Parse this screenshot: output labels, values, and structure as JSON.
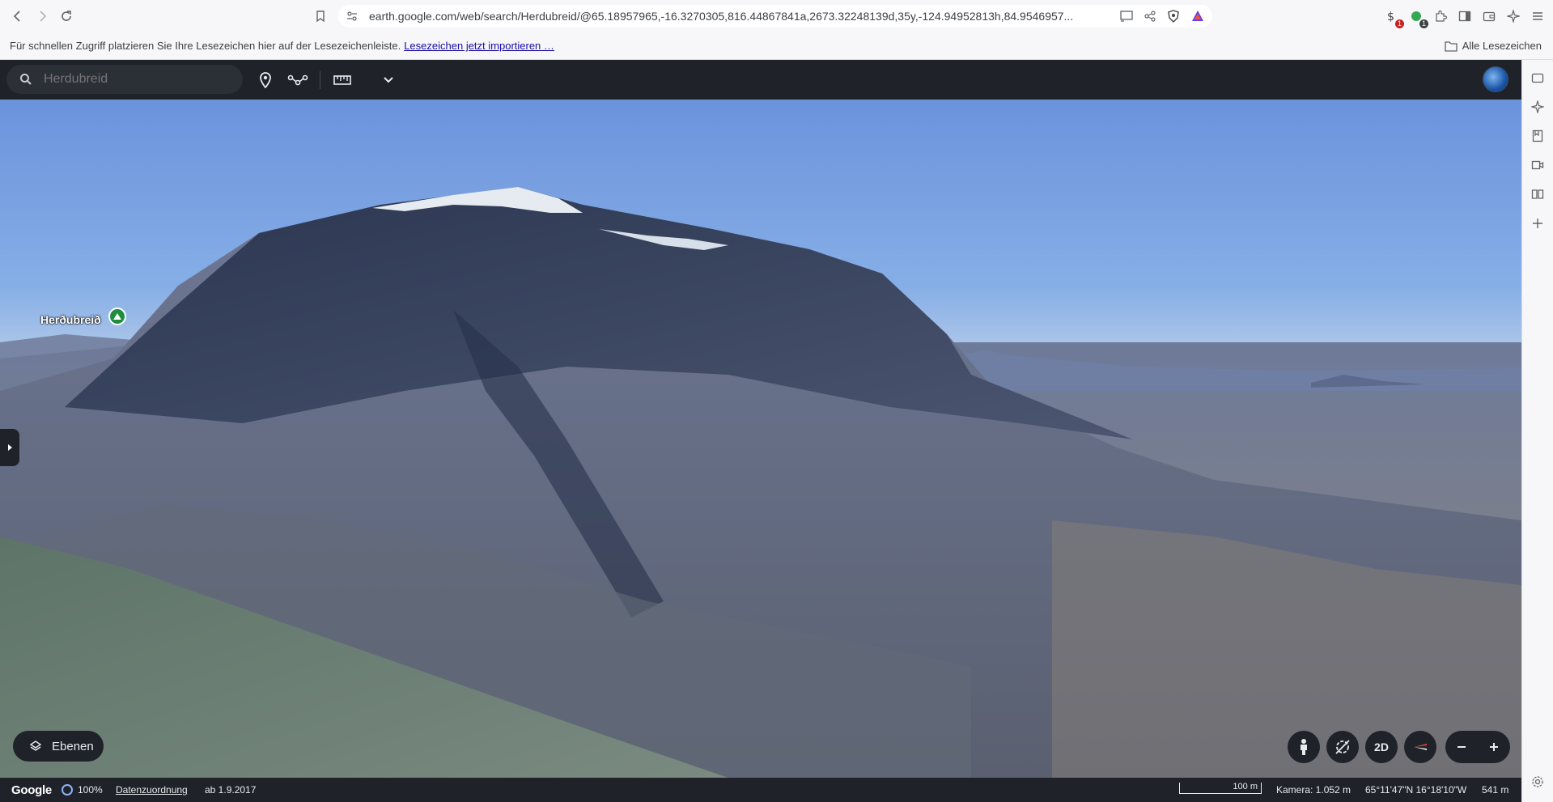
{
  "browser": {
    "url": "earth.google.com/web/search/Herdubreid/@65.18957965,-16.3270305,816.44867841a,2673.32248139d,35y,-124.94952813h,84.9546957...",
    "extensions": [
      {
        "name": "extension-icon",
        "badge": "1"
      },
      {
        "name": "extension-icon",
        "badge": "1"
      }
    ]
  },
  "bookmarks_bar": {
    "hint": "Für schnellen Zugriff platzieren Sie Ihre Lesezeichen hier auf der Lesezeichenleiste.",
    "import_link": "Lesezeichen jetzt importieren …",
    "all_bookmarks": "Alle Lesezeichen"
  },
  "earth": {
    "search": {
      "value": "",
      "placeholder": "Herdubreid"
    },
    "place_label": "Herðubreið",
    "layers_label": "Ebenen",
    "view_mode_label": "2D",
    "status": {
      "brand": "Google",
      "progress": "100%",
      "attribution": "Datenzuordnung",
      "imagery_date": "ab 1.9.2017",
      "scale": "100 m",
      "camera": "Kamera: 1.052 m",
      "coordinates": "65°11'47\"N 16°18'10\"W",
      "elevation": "541 m"
    }
  },
  "colors": {
    "app_bar": "#1f2228",
    "sky": "#6f94d6",
    "link": "#1a0dab",
    "pin": "#1e8e3e"
  }
}
